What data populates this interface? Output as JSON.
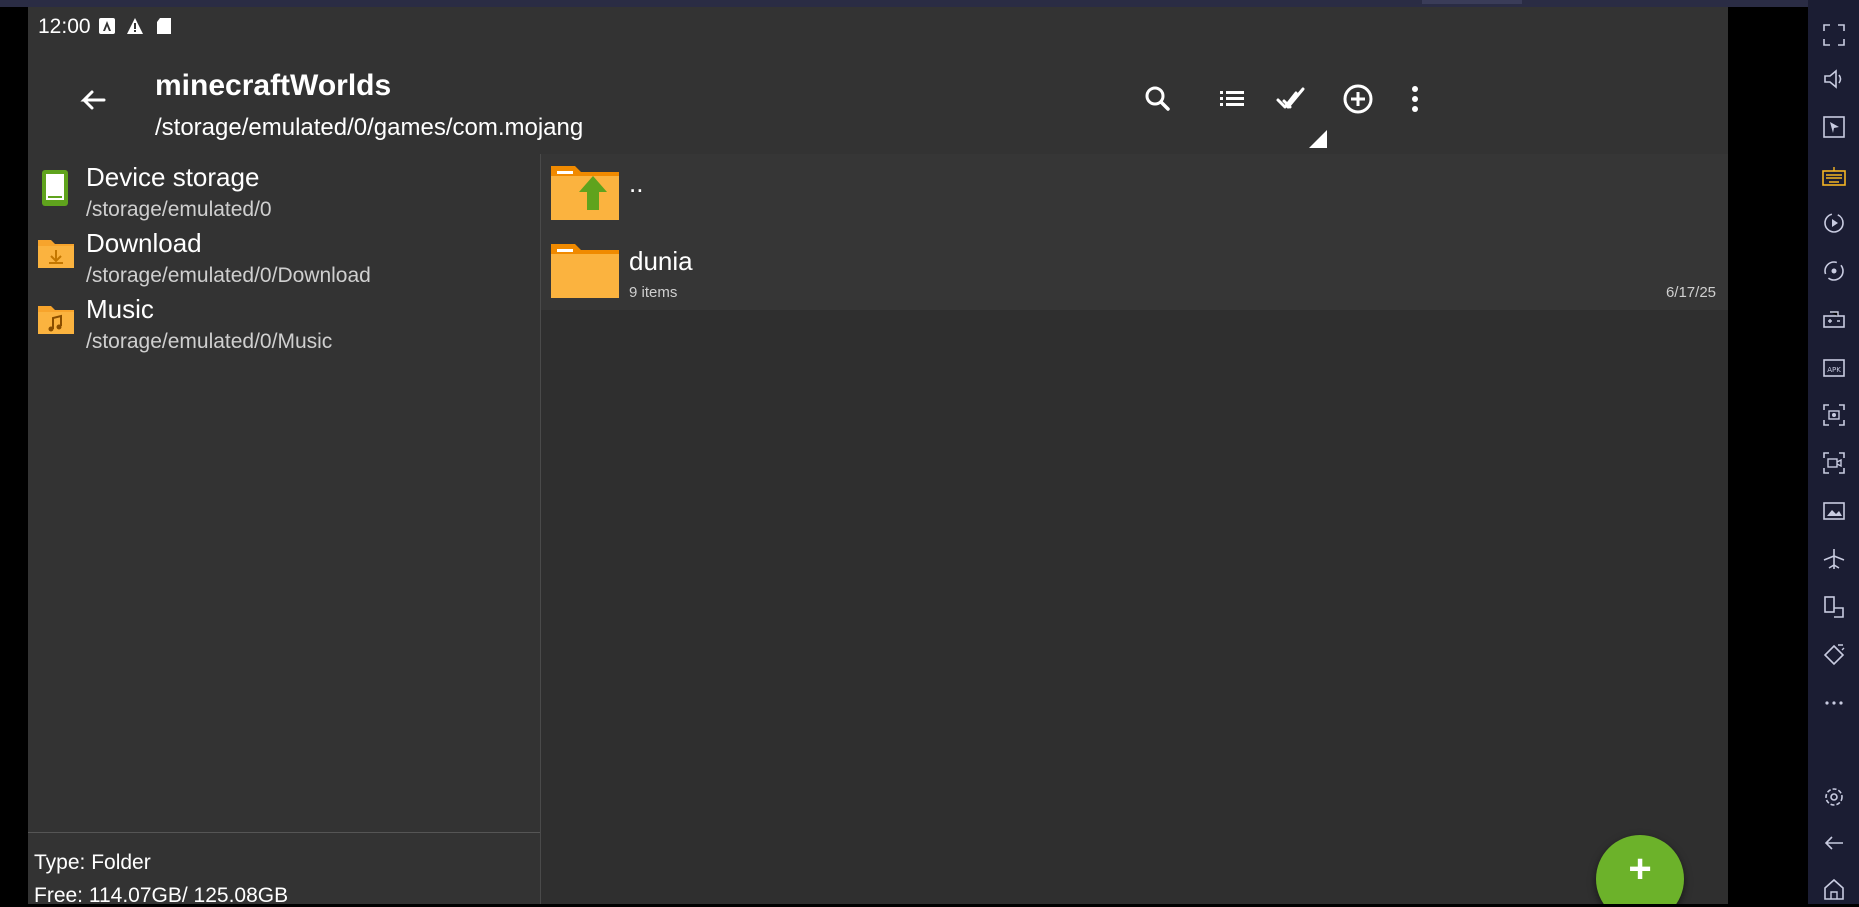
{
  "status_bar": {
    "time": "12:00"
  },
  "app_bar": {
    "title": "minecraftWorlds",
    "subtitle": "/storage/emulated/0/games/com.mojang",
    "icons": [
      "back-icon",
      "search-icon",
      "list-view-icon",
      "select-all-icon",
      "add-circle-icon",
      "more-vert-icon"
    ]
  },
  "bookmarks": [
    {
      "name": "Device storage",
      "path": "/storage/emulated/0",
      "icon": "device-storage-icon",
      "color": "#5fa31d"
    },
    {
      "name": "Download",
      "path": "/storage/emulated/0/Download",
      "icon": "download-folder-icon",
      "color": "#f7a42c"
    },
    {
      "name": "Music",
      "path": "/storage/emulated/0/Music",
      "icon": "music-folder-icon",
      "color": "#f7a42c"
    }
  ],
  "info": {
    "type": "Type: Folder",
    "free": "Free: 114.07GB/ 125.08GB"
  },
  "files": [
    {
      "name": "..",
      "meta": "",
      "date": "",
      "icon": "parent-folder-icon"
    },
    {
      "name": "dunia",
      "meta": "9 items",
      "date": "6/17/25",
      "icon": "folder-icon"
    }
  ],
  "fab": {
    "label": "+"
  },
  "colors": {
    "background": "#333333",
    "folder": "#f7a42c",
    "accent": "#6cb22a",
    "emulator_sidebar": "#1b1d33"
  },
  "emulator_sidebar": [
    "fullscreen-icon",
    "volume-icon",
    "pointer-icon",
    "keyboard-icon",
    "record-icon",
    "rotate-icon",
    "gamepad-icon",
    "apk-install-icon",
    "screenshot-icon",
    "screen-record-icon",
    "gallery-icon",
    "airplane-icon",
    "multi-instance-icon",
    "shake-icon",
    "more-icon",
    "settings-icon",
    "back-icon",
    "home-icon"
  ]
}
